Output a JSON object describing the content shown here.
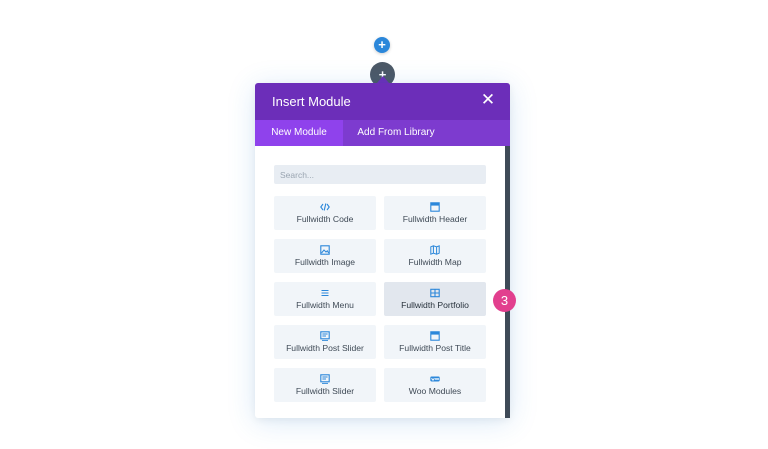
{
  "add_section_label": "+",
  "add_row_label": "+",
  "modal": {
    "title": "Insert Module",
    "close_glyph": "✕",
    "tabs": [
      {
        "label": "New Module",
        "active": true
      },
      {
        "label": "Add From Library",
        "active": false
      }
    ],
    "search": {
      "placeholder": "Search..."
    },
    "modules": [
      {
        "label": "Fullwidth Code",
        "icon": "code-icon"
      },
      {
        "label": "Fullwidth Header",
        "icon": "header-icon"
      },
      {
        "label": "Fullwidth Image",
        "icon": "image-icon"
      },
      {
        "label": "Fullwidth Map",
        "icon": "map-icon"
      },
      {
        "label": "Fullwidth Menu",
        "icon": "menu-icon"
      },
      {
        "label": "Fullwidth Portfolio",
        "icon": "portfolio-icon",
        "active": true
      },
      {
        "label": "Fullwidth Post Slider",
        "icon": "post-slider-icon"
      },
      {
        "label": "Fullwidth Post Title",
        "icon": "post-title-icon"
      },
      {
        "label": "Fullwidth Slider",
        "icon": "slider-icon"
      },
      {
        "label": "Woo Modules",
        "icon": "woo-icon"
      }
    ]
  },
  "step_badge": "3",
  "colors": {
    "header": "#6c2eb9",
    "tab_bar": "#7d3bcf",
    "active_tab": "#8f42ec",
    "icon_blue": "#2b87da",
    "badge_pink": "#e23f8e"
  }
}
